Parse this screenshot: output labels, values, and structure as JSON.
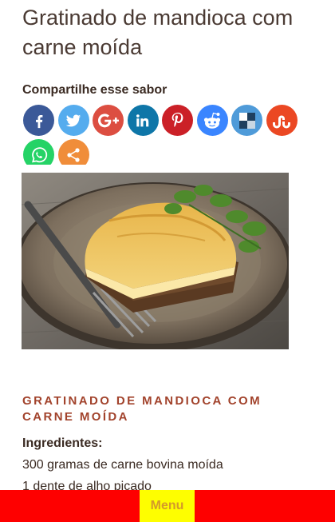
{
  "post": {
    "title": "Gratinado de mandioca com carne moída"
  },
  "share": {
    "heading": "Compartilhe esse sabor",
    "buttons": [
      {
        "icon": "facebook-icon",
        "glyph": "f",
        "color": "#3b5998"
      },
      {
        "icon": "twitter-icon",
        "glyph": "t",
        "color": "#55acee"
      },
      {
        "icon": "google-plus-icon",
        "glyph": "G+",
        "color": "#dc4e41"
      },
      {
        "icon": "linkedin-icon",
        "glyph": "in",
        "color": "#0e76a8"
      },
      {
        "icon": "pinterest-icon",
        "glyph": "p",
        "color": "#cb2027"
      },
      {
        "icon": "reddit-icon",
        "glyph": "r",
        "color": "#3a85ff"
      },
      {
        "icon": "delicious-icon",
        "glyph": "d",
        "color": "#4f9bd9"
      },
      {
        "icon": "stumbleupon-icon",
        "glyph": "su",
        "color": "#eb4823"
      },
      {
        "icon": "whatsapp-icon",
        "glyph": "w",
        "color": "#25d366"
      },
      {
        "icon": "more-share-icon",
        "glyph": "<",
        "color": "#f08d3a"
      }
    ]
  },
  "recipe": {
    "title": "GRATINADO DE MANDIOCA COM CARNE MOÍDA",
    "ingredients_heading": "Ingredientes:",
    "ingredients": [
      "300 gramas de carne bovina moída",
      "1 dente de alho picado"
    ]
  },
  "menu": {
    "label": "Menu"
  },
  "colors": {
    "accent": "#a2432c",
    "menu_bar": "#fe0000",
    "menu_button": "#fefe00"
  }
}
